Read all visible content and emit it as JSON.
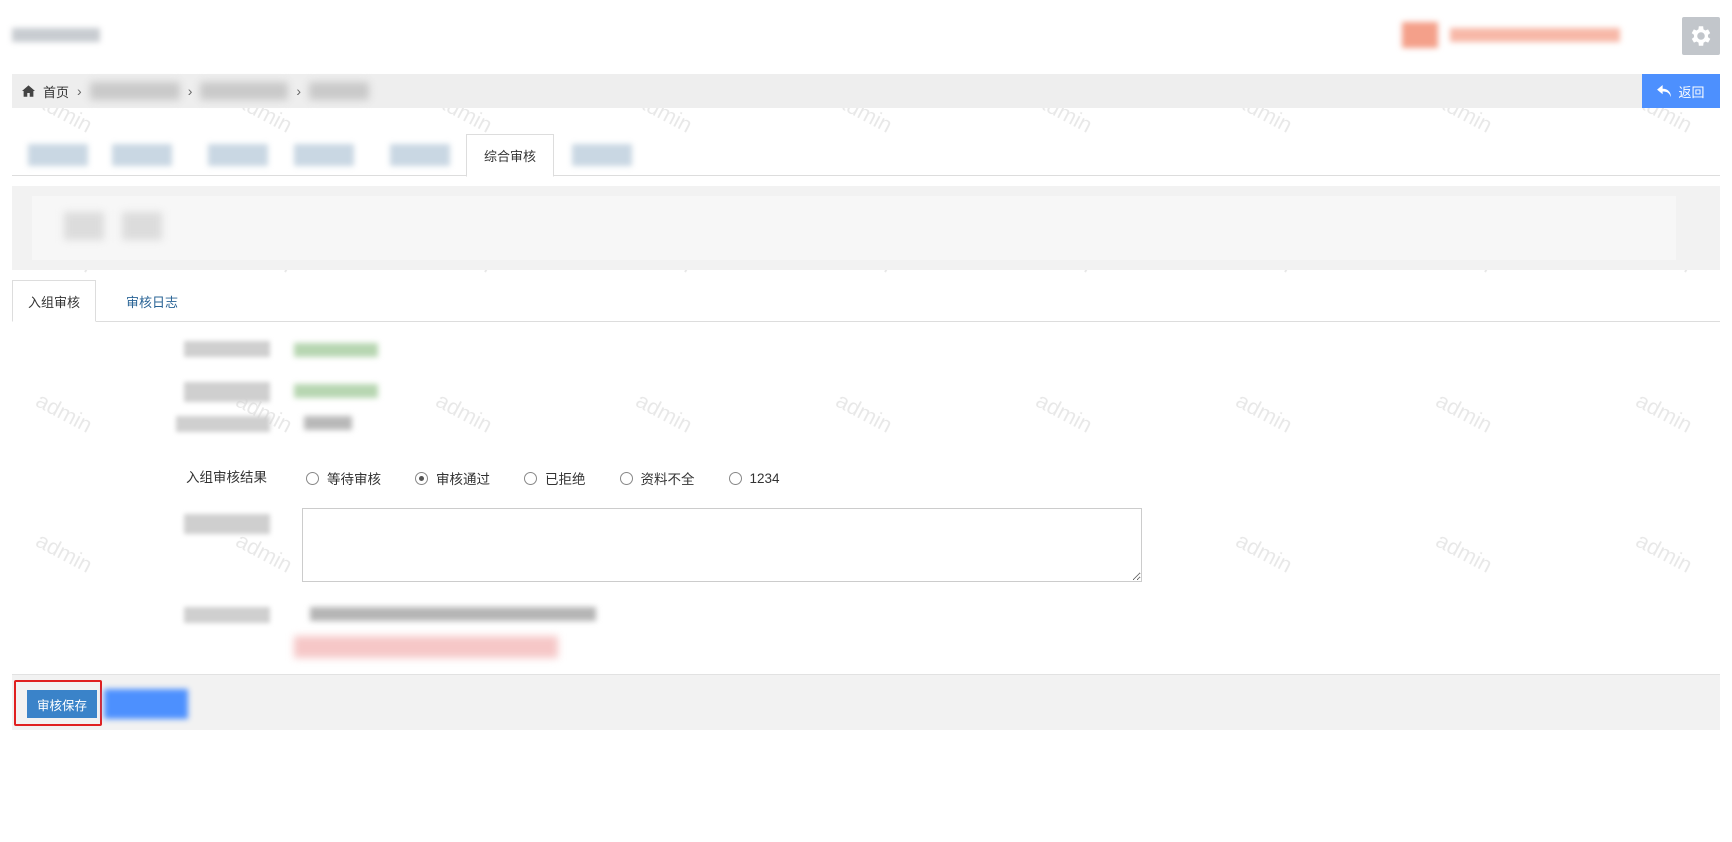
{
  "header": {
    "settings_icon": "gear-icon"
  },
  "breadcrumb": {
    "home_icon": "home-icon",
    "home_label": "首页",
    "separator": "›"
  },
  "back_button": {
    "icon": "undo-arrow-icon",
    "label": "返回"
  },
  "top_tabs": {
    "active_label": "综合审核"
  },
  "sub_tabs": {
    "items": [
      {
        "label": "入组审核",
        "active": true
      },
      {
        "label": "审核日志",
        "active": false
      }
    ]
  },
  "form": {
    "result_label": "入组审核结果",
    "options": [
      {
        "label": "等待审核",
        "checked": false
      },
      {
        "label": "审核通过",
        "checked": true
      },
      {
        "label": "已拒绝",
        "checked": false
      },
      {
        "label": "资料不全",
        "checked": false
      },
      {
        "label": "1234",
        "checked": false
      }
    ]
  },
  "footer": {
    "save_label": "审核保存"
  },
  "watermark": {
    "text": "admin"
  },
  "colors": {
    "primary": "#4d90fe",
    "save_button": "#3a83c9",
    "highlight": "#e02020"
  }
}
